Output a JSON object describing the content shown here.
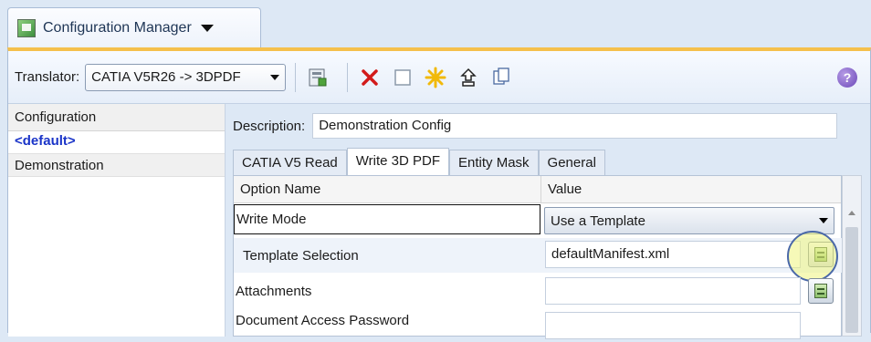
{
  "app_tab": {
    "title": "Configuration Manager"
  },
  "toolbar": {
    "translator_label": "Translator:",
    "translator_value": "CATIA V5R26 -> 3DPDF",
    "help_label": "?"
  },
  "sidebar": {
    "header": "Configuration",
    "items": [
      "<default>",
      "Demonstration"
    ]
  },
  "description": {
    "label": "Description:",
    "value": "Demonstration Config"
  },
  "tabs": [
    "CATIA V5 Read",
    "Write 3D PDF",
    "Entity Mask",
    "General"
  ],
  "active_tab": "Write 3D PDF",
  "grid": {
    "columns": [
      "Option Name",
      "Value"
    ],
    "rows": [
      {
        "name": "Write Mode",
        "value": "Use a Template"
      },
      {
        "name": "Template Selection",
        "value": "defaultManifest.xml"
      },
      {
        "name": "Attachments",
        "value": ""
      },
      {
        "name": "Document Access Password",
        "value": ""
      }
    ]
  },
  "colors": {
    "accent": "#f5c04c",
    "link": "#1a34c8",
    "highlight": "#eef47d"
  }
}
